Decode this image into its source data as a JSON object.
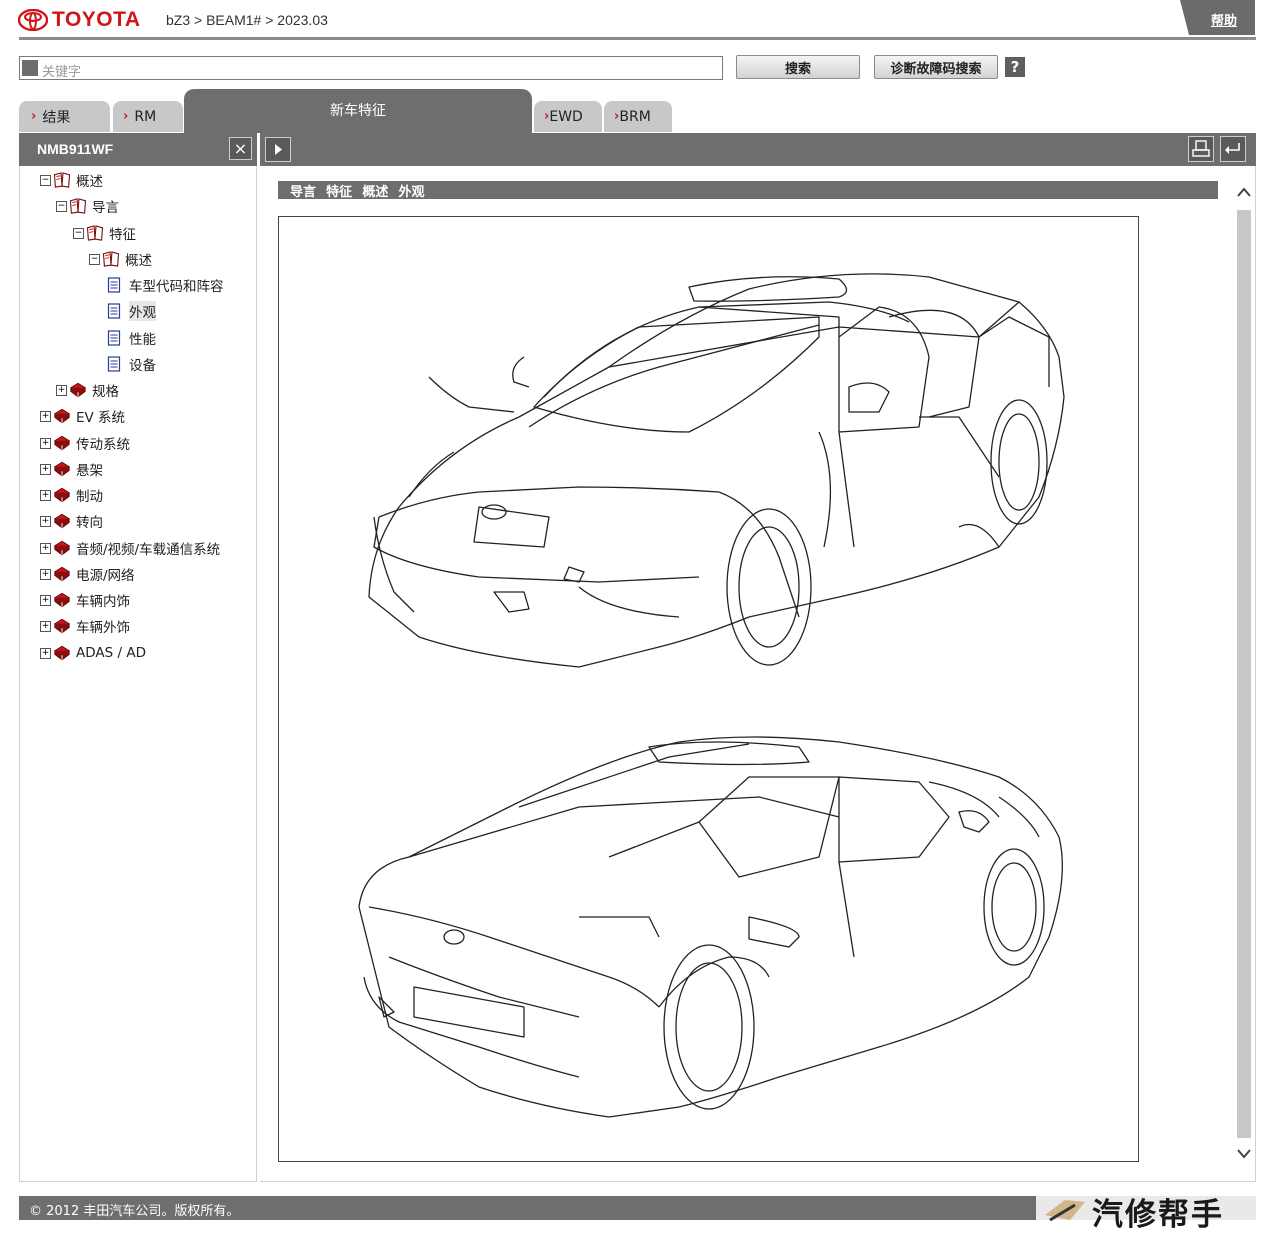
{
  "header": {
    "brand": "TOYOTA",
    "breadcrumb": "bZ3 > BEAM1# > 2023.03",
    "help_label": "帮助"
  },
  "search": {
    "placeholder": "关键字",
    "search_button": "搜索",
    "diag_button": "诊断故障码搜索",
    "help_icon": "?"
  },
  "tabs": [
    {
      "label": "结果"
    },
    {
      "label": "RM"
    },
    {
      "label": "新车特征",
      "active": true
    },
    {
      "label": "EWD"
    },
    {
      "label": "BRM"
    }
  ],
  "sidebar": {
    "title": "NMB911WF",
    "close_icon": "×",
    "tree": [
      {
        "label": "概述"
      },
      {
        "label": "导言"
      },
      {
        "label": "特征"
      },
      {
        "label": "概述"
      },
      {
        "label": "车型代码和阵容"
      },
      {
        "label": "外观",
        "selected": true
      },
      {
        "label": "性能"
      },
      {
        "label": "设备"
      },
      {
        "label": "规格"
      },
      {
        "label": "EV 系统"
      },
      {
        "label": "传动系统"
      },
      {
        "label": "悬架"
      },
      {
        "label": "制动"
      },
      {
        "label": "转向"
      },
      {
        "label": "音频/视频/车载通信系统"
      },
      {
        "label": "电源/网络"
      },
      {
        "label": "车辆内饰"
      },
      {
        "label": "车辆外饰"
      },
      {
        "label": "ADAS / AD"
      }
    ]
  },
  "content": {
    "crumbs": [
      "导言",
      "特征",
      "概述",
      "外观"
    ],
    "figure_icon": "car-front-and-rear-line-drawing"
  },
  "footer": {
    "copyright": "© 2012 丰田汽车公司。版权所有。",
    "watermark": "汽修帮手"
  },
  "colors": {
    "brand_red": "#d0161b",
    "bar_gray": "#6e6e6e"
  }
}
